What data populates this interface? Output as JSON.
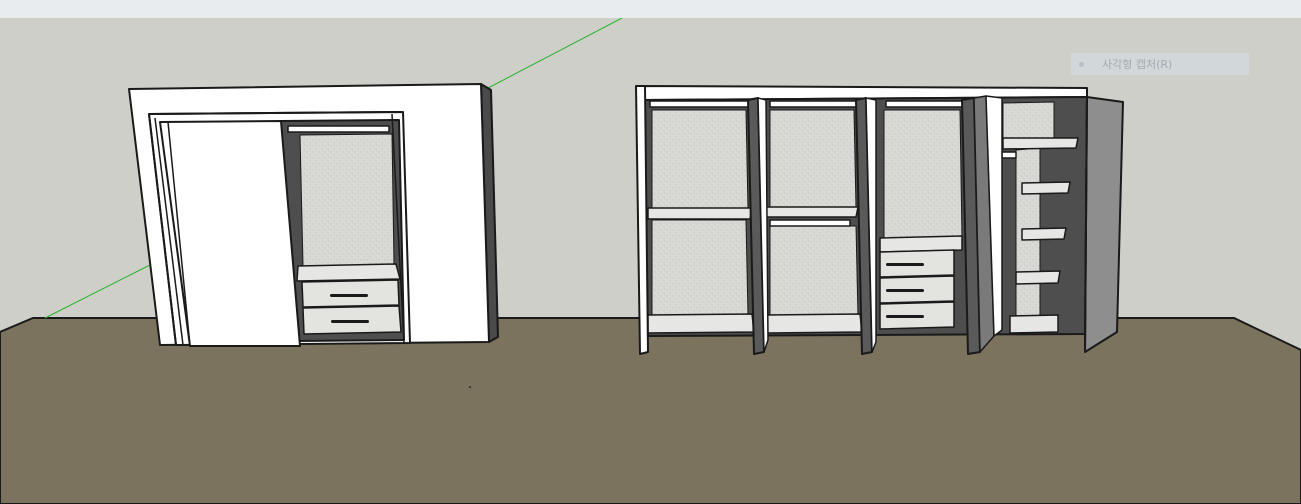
{
  "tooltip": {
    "icon": "rectangle-capture-icon",
    "label": "사각형 캡처(R)"
  },
  "colors": {
    "wall": "#cfcfca",
    "floor": "#7c735f",
    "axis_green": "#2bb32b",
    "edge": "#1a1a1a",
    "carcass": "#ffffff",
    "interior_shadow": "#5a5a5a",
    "back_panel": "#d9d9d6"
  },
  "scene": {
    "left_wardrobe": {
      "type": "sliding",
      "drawers": 2
    },
    "right_wardrobe": {
      "type": "hinged",
      "sections": 4,
      "drawers": 3
    }
  }
}
